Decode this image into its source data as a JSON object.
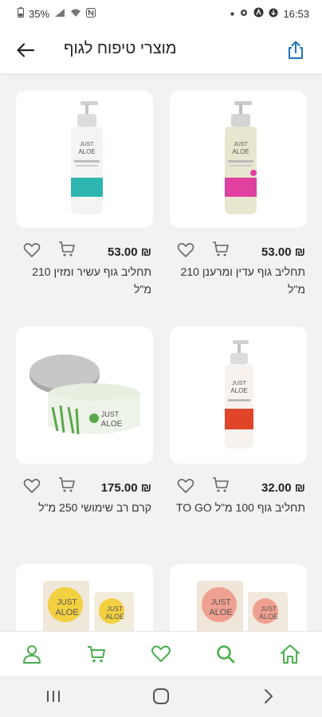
{
  "status_bar": {
    "battery": "35%",
    "time": "16:53"
  },
  "header": {
    "title": "מוצרי טיפוח לגוף"
  },
  "products": [
    {
      "price": "53.00 ₪",
      "name": "תחליב גוף עדין ומרענן 210 מ\"ל",
      "accent": "#e040a0"
    },
    {
      "price": "53.00 ₪",
      "name": "תחליב גוף עשיר ומזין 210 מ\"ל",
      "accent": "#2fb5b0"
    },
    {
      "price": "32.00 ₪",
      "name": "תחליב גוף 100 מ\"ל TO GO",
      "accent": "#e0452a"
    },
    {
      "price": "175.00 ₪",
      "name": "קרם רב שימושי 250 מ\"ל",
      "accent": "#5aa84a"
    },
    {
      "price": "",
      "name": "",
      "accent": "#f0a090"
    },
    {
      "price": "",
      "name": "",
      "accent": "#f2d040"
    }
  ],
  "product_logo": {
    "line1": "JUST",
    "line2": "ALOE"
  },
  "colors": {
    "brand_green": "#4caf50",
    "share_blue": "#1e73be"
  },
  "icons": {
    "back": "arrow-left-icon",
    "share": "share-icon",
    "heart": "heart-icon",
    "cart": "cart-icon",
    "profile": "user-icon",
    "search": "search-icon",
    "home": "home-icon"
  }
}
